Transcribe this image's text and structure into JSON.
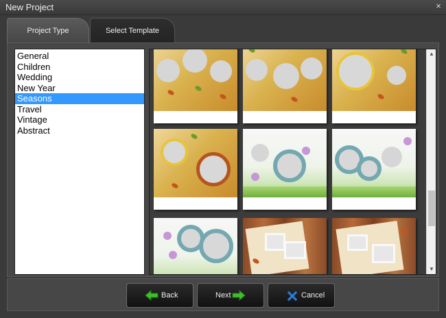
{
  "window": {
    "title": "New Project",
    "close_glyph": "×"
  },
  "tabs": [
    {
      "label": "Project Type",
      "active": false
    },
    {
      "label": "Select Template",
      "active": true
    }
  ],
  "categories": [
    {
      "label": "General"
    },
    {
      "label": "Children"
    },
    {
      "label": "Wedding"
    },
    {
      "label": "New Year"
    },
    {
      "label": "Seasons",
      "selected": true
    },
    {
      "label": "Travel"
    },
    {
      "label": "Vintage"
    },
    {
      "label": "Abstract"
    }
  ],
  "gallery": {
    "templates": [
      "autumn",
      "autumn",
      "autumn",
      "autumn",
      "spring",
      "spring",
      "spring",
      "wood",
      "wood"
    ],
    "scroll_up_glyph": "▲",
    "scroll_down_glyph": "▼"
  },
  "buttons": {
    "back_label": "Back",
    "next_label": "Next",
    "cancel_label": "Cancel"
  },
  "colors": {
    "selection": "#3399ff",
    "arrow_green": "#3fbf2b",
    "cancel_blue": "#2f83d8"
  },
  "icons": {
    "back": "arrow-left-icon",
    "next": "arrow-right-icon",
    "cancel": "x-icon",
    "close": "close-icon"
  }
}
